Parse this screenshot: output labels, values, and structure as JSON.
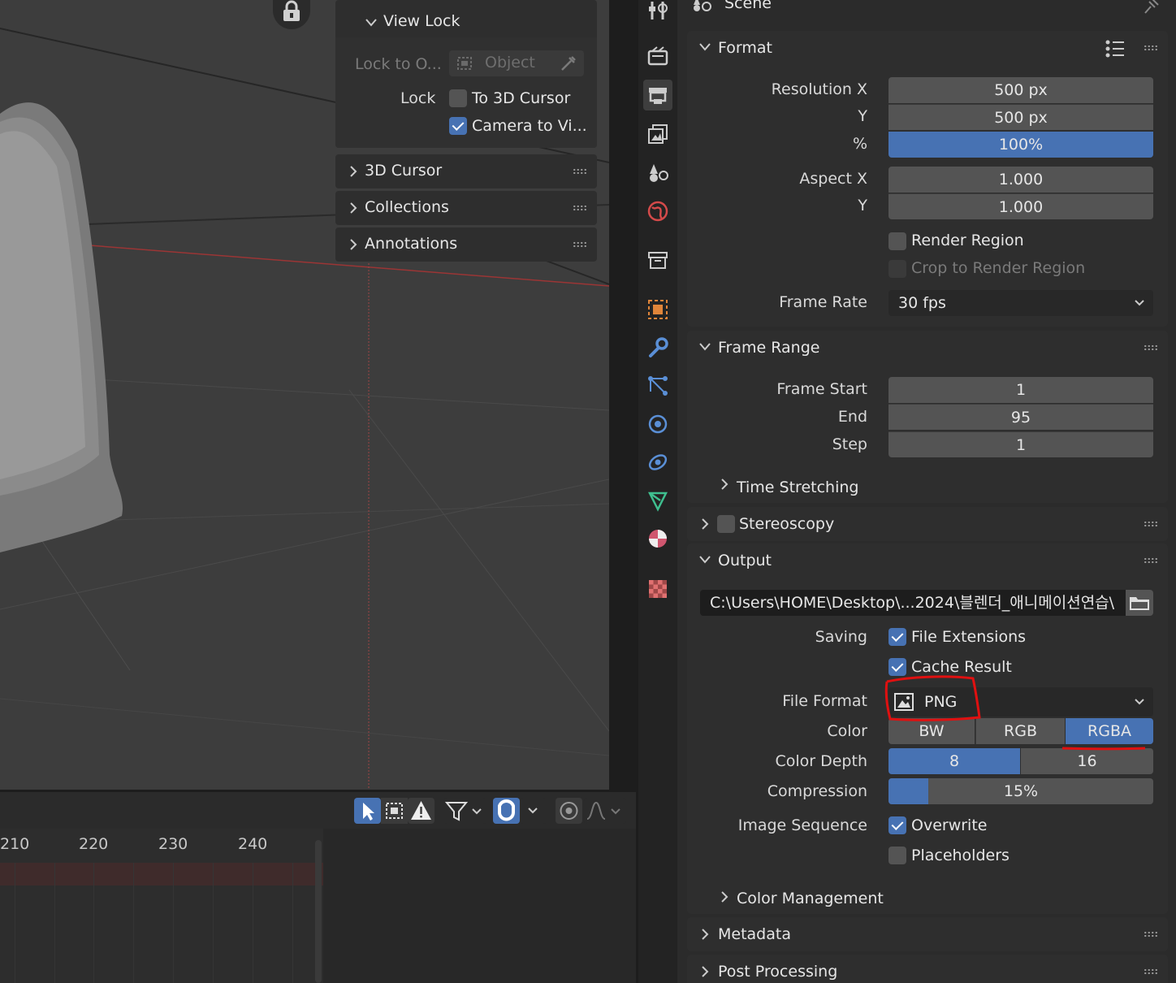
{
  "viewport": {
    "view_lock": {
      "title": "View Lock",
      "lock_to_object_label": "Lock to O...",
      "lock_to_object_placeholder": "Object",
      "lock_label": "Lock",
      "to_3d_cursor": "To 3D Cursor",
      "camera_to_view": "Camera to Vi..."
    },
    "panels": [
      "3D Cursor",
      "Collections",
      "Annotations"
    ]
  },
  "timeline": {
    "frames": [
      "210",
      "220",
      "230",
      "240"
    ]
  },
  "properties": {
    "context": "Scene",
    "format": {
      "title": "Format",
      "resolution_x_label": "Resolution X",
      "resolution_x": "500 px",
      "y_label": "Y",
      "resolution_y": "500 px",
      "percent_label": "%",
      "percent": "100%",
      "aspect_x_label": "Aspect X",
      "aspect_x": "1.000",
      "aspect_y_label": "Y",
      "aspect_y": "1.000",
      "render_region": "Render Region",
      "crop_to_render_region": "Crop to Render Region",
      "frame_rate_label": "Frame Rate",
      "frame_rate": "30 fps"
    },
    "frame_range": {
      "title": "Frame Range",
      "start_label": "Frame Start",
      "start": "1",
      "end_label": "End",
      "end": "95",
      "step_label": "Step",
      "step": "1",
      "time_stretching": "Time Stretching"
    },
    "stereoscopy": {
      "title": "Stereoscopy"
    },
    "output": {
      "title": "Output",
      "path": "C:\\Users\\HOME\\Desktop\\...2024\\블렌더_애니메이션연습\\",
      "saving_label": "Saving",
      "file_extensions": "File Extensions",
      "cache_result": "Cache Result",
      "file_format_label": "File Format",
      "file_format": "PNG",
      "color_label": "Color",
      "color_options": [
        "BW",
        "RGB",
        "RGBA"
      ],
      "color_depth_label": "Color Depth",
      "color_depth_options": [
        "8",
        "16"
      ],
      "compression_label": "Compression",
      "compression": "15%",
      "compression_fraction": 0.15,
      "image_sequence_label": "Image Sequence",
      "overwrite": "Overwrite",
      "placeholders": "Placeholders",
      "color_management": "Color Management"
    },
    "metadata": {
      "title": "Metadata"
    },
    "post_processing": {
      "title": "Post Processing"
    }
  },
  "colors": {
    "accent_blue": "#4772b3",
    "annotation_red": "#e01010"
  }
}
